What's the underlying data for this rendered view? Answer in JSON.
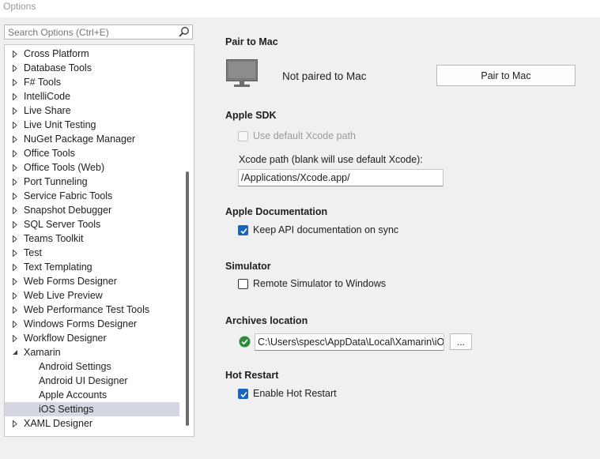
{
  "window": {
    "title": "Options"
  },
  "search": {
    "placeholder": "Search Options (Ctrl+E)"
  },
  "tree": {
    "items": [
      {
        "label": "Cross Platform",
        "expandable": true,
        "expanded": false
      },
      {
        "label": "Database Tools",
        "expandable": true,
        "expanded": false
      },
      {
        "label": "F# Tools",
        "expandable": true,
        "expanded": false
      },
      {
        "label": "IntelliCode",
        "expandable": true,
        "expanded": false
      },
      {
        "label": "Live Share",
        "expandable": true,
        "expanded": false
      },
      {
        "label": "Live Unit Testing",
        "expandable": true,
        "expanded": false
      },
      {
        "label": "NuGet Package Manager",
        "expandable": true,
        "expanded": false
      },
      {
        "label": "Office Tools",
        "expandable": true,
        "expanded": false
      },
      {
        "label": "Office Tools (Web)",
        "expandable": true,
        "expanded": false
      },
      {
        "label": "Port Tunneling",
        "expandable": true,
        "expanded": false
      },
      {
        "label": "Service Fabric Tools",
        "expandable": true,
        "expanded": false
      },
      {
        "label": "Snapshot Debugger",
        "expandable": true,
        "expanded": false
      },
      {
        "label": "SQL Server Tools",
        "expandable": true,
        "expanded": false
      },
      {
        "label": "Teams Toolkit",
        "expandable": true,
        "expanded": false
      },
      {
        "label": "Test",
        "expandable": true,
        "expanded": false
      },
      {
        "label": "Text Templating",
        "expandable": true,
        "expanded": false
      },
      {
        "label": "Web Forms Designer",
        "expandable": true,
        "expanded": false
      },
      {
        "label": "Web Live Preview",
        "expandable": true,
        "expanded": false
      },
      {
        "label": "Web Performance Test Tools",
        "expandable": true,
        "expanded": false
      },
      {
        "label": "Windows Forms Designer",
        "expandable": true,
        "expanded": false
      },
      {
        "label": "Workflow Designer",
        "expandable": true,
        "expanded": false
      },
      {
        "label": "Xamarin",
        "expandable": true,
        "expanded": true
      },
      {
        "label": "Android Settings",
        "child": true
      },
      {
        "label": "Android UI Designer",
        "child": true
      },
      {
        "label": "Apple Accounts",
        "child": true
      },
      {
        "label": "iOS Settings",
        "child": true,
        "selected": true
      },
      {
        "label": "XAML Designer",
        "expandable": true,
        "expanded": false
      }
    ]
  },
  "pair": {
    "heading": "Pair to Mac",
    "status": "Not paired to Mac",
    "button_label": "Pair to Mac"
  },
  "sdk": {
    "heading": "Apple SDK",
    "default_path_label": "Use default Xcode path",
    "default_path_checked": false,
    "default_path_disabled": true,
    "xcode_label": "Xcode path (blank will use default Xcode):",
    "xcode_value": "/Applications/Xcode.app/"
  },
  "docs": {
    "heading": "Apple Documentation",
    "sync_label": "Keep API documentation on sync",
    "sync_checked": true
  },
  "simulator": {
    "heading": "Simulator",
    "remote_label": "Remote Simulator to Windows",
    "remote_checked": false
  },
  "archives": {
    "heading": "Archives location",
    "path_value": "C:\\Users\\spesc\\AppData\\Local\\Xamarin\\iOS",
    "browse_label": "...",
    "status_icon": "check-circle-icon"
  },
  "hot_restart": {
    "heading": "Hot Restart",
    "enable_label": "Enable Hot Restart",
    "enable_checked": true
  },
  "colors": {
    "accent": "#1565c0",
    "selection": "#d4d6e2",
    "ok_green": "#2e8b3a"
  }
}
